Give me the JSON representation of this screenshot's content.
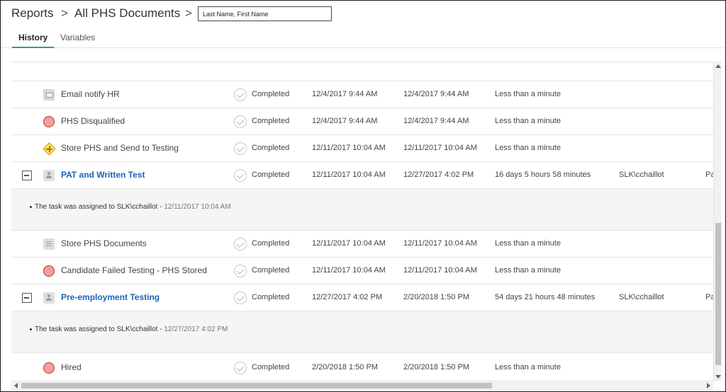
{
  "header": {
    "breadcrumb_root": "Reports",
    "breadcrumb_current": "All PHS Documents",
    "separator": ">",
    "name_input_value": "Last Name, First Name"
  },
  "tabs": [
    {
      "label": "History",
      "active": true
    },
    {
      "label": "Variables",
      "active": false
    }
  ],
  "accent_color": "#17a49a",
  "link_color": "#1a63b8",
  "rows": [
    {
      "name": "Email notify HR",
      "icon": "mail-icon",
      "status": "Completed",
      "started": "12/4/2017 9:44 AM",
      "completed": "12/4/2017 9:44 AM",
      "duration": "Less than a minute"
    },
    {
      "name": "PHS Disqualified",
      "icon": "stop-event-icon",
      "status": "Completed",
      "started": "12/4/2017 9:44 AM",
      "completed": "12/4/2017 9:44 AM",
      "duration": "Less than a minute"
    },
    {
      "name": "Store PHS and Send to Testing",
      "icon": "gateway-icon",
      "status": "Completed",
      "started": "12/11/2017 10:04 AM",
      "completed": "12/11/2017 10:04 AM",
      "duration": "Less than a minute"
    },
    {
      "name": "PAT and Written Test",
      "icon": "user-task-icon",
      "status": "Completed",
      "started": "12/11/2017 10:04 AM",
      "completed": "12/27/2017 4:02 PM",
      "duration": "16 days 5 hours 58 minutes",
      "user": "SLK\\cchaillot",
      "extra": "Pa",
      "expanded": true,
      "note": "The task was assigned to SLK\\cchaillot - ",
      "note_time": "12/11/2017 10:04 AM"
    },
    {
      "name": "Store PHS Documents",
      "icon": "script-icon",
      "status": "Completed",
      "started": "12/11/2017 10:04 AM",
      "completed": "12/11/2017 10:04 AM",
      "duration": "Less than a minute"
    },
    {
      "name": "Candidate Failed Testing - PHS Stored",
      "icon": "stop-event-icon",
      "status": "Completed",
      "started": "12/11/2017 10:04 AM",
      "completed": "12/11/2017 10:04 AM",
      "duration": "Less than a minute"
    },
    {
      "name": "Pre-employment Testing",
      "icon": "user-task-icon",
      "status": "Completed",
      "started": "12/27/2017 4:02 PM",
      "completed": "2/20/2018 1:50 PM",
      "duration": "54 days 21 hours 48 minutes",
      "user": "SLK\\cchaillot",
      "extra": "Pa",
      "expanded": true,
      "note": "The task was assigned to SLK\\cchaillot - ",
      "note_time": "12/27/2017 4:02 PM"
    },
    {
      "name": "Hired",
      "icon": "stop-event-icon",
      "status": "Completed",
      "started": "2/20/2018 1:50 PM",
      "completed": "2/20/2018 1:50 PM",
      "duration": "Less than a minute"
    }
  ]
}
